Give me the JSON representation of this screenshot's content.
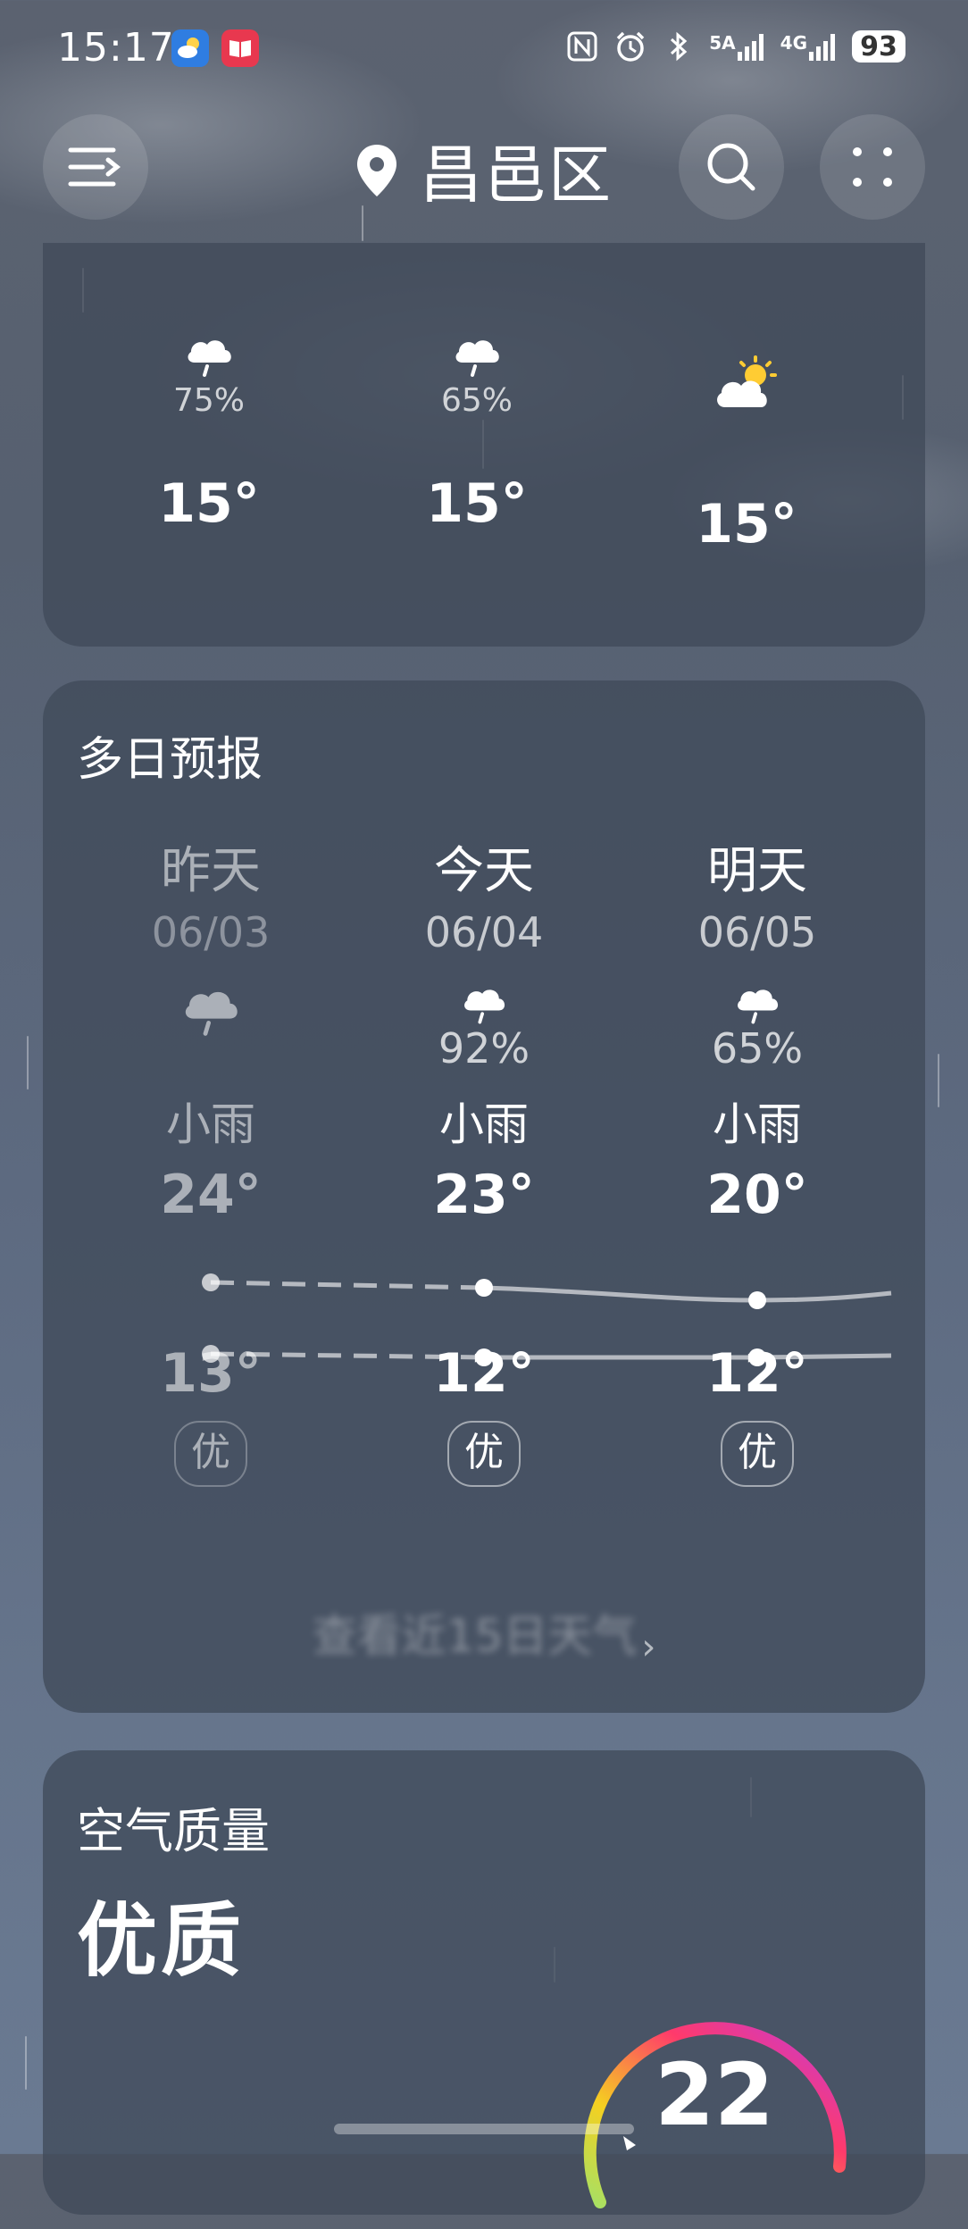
{
  "status_bar": {
    "time": "15:17",
    "signal_5a": "5A",
    "signal_4g": "4G",
    "battery": "93"
  },
  "header": {
    "location": "昌邑区",
    "icons": [
      "menu-icon",
      "location-pin-icon",
      "search-icon",
      "more-dots-icon"
    ]
  },
  "hourly": [
    {
      "icon": "rain-cloud-icon",
      "precip": "75%",
      "temp": "15°"
    },
    {
      "icon": "rain-cloud-icon",
      "precip": "65%",
      "temp": "15°"
    },
    {
      "icon": "partly-cloudy-icon",
      "precip": "",
      "temp": "15°"
    }
  ],
  "multi_day": {
    "title": "多日预报",
    "days": [
      {
        "name": "昨天",
        "date": "06/03",
        "icon": "rain-cloud-icon",
        "precip": "",
        "weather": "小雨",
        "high": "24°",
        "low": "13°",
        "aqi": "优"
      },
      {
        "name": "今天",
        "date": "06/04",
        "icon": "rain-cloud-icon",
        "precip": "92%",
        "weather": "小雨",
        "high": "23°",
        "low": "12°",
        "aqi": "优"
      },
      {
        "name": "明天",
        "date": "06/05",
        "icon": "rain-cloud-icon",
        "precip": "65%",
        "weather": "小雨",
        "high": "20°",
        "low": "12°",
        "aqi": "优"
      }
    ],
    "more_link": "查看近15日天气"
  },
  "air_quality": {
    "title": "空气质量",
    "level": "优质",
    "value": "22"
  },
  "colors": {
    "gauge_start": "#f5d020",
    "gauge_mid": "#ff3a6b",
    "gauge_end": "#c43bd8"
  }
}
